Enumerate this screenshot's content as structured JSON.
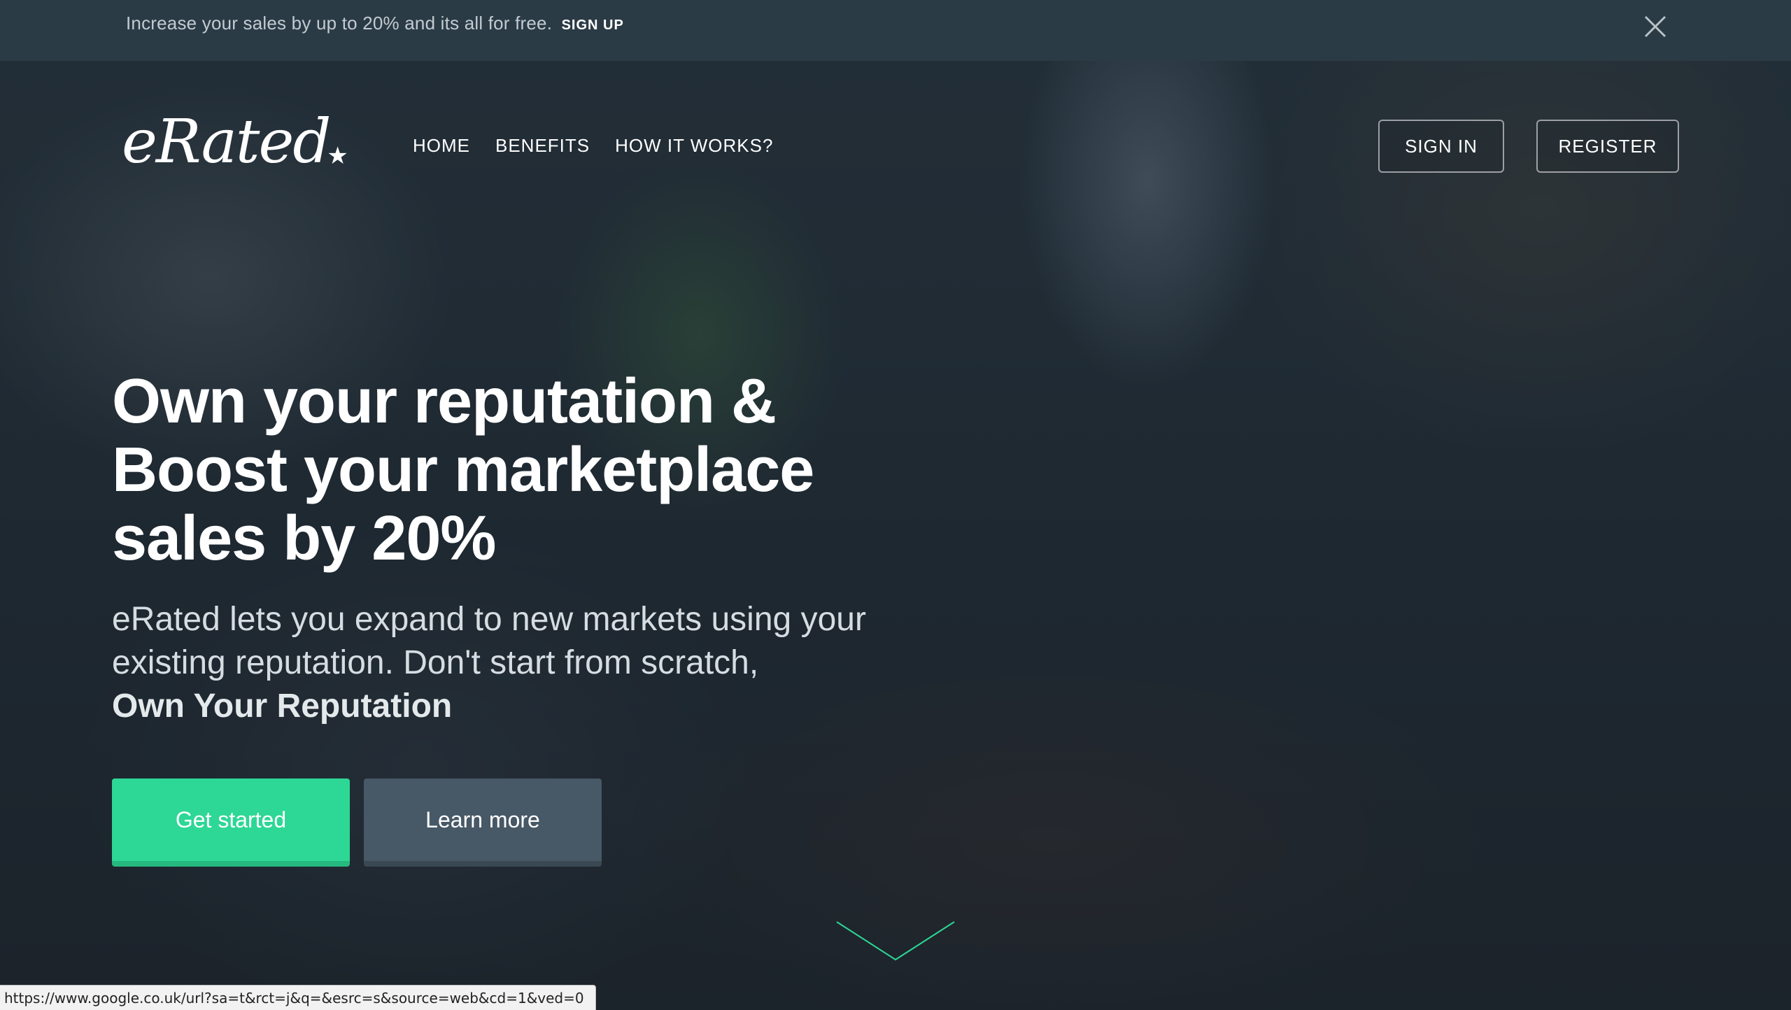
{
  "announcement": {
    "text": "Increase your sales by up to 20% and its all for free.",
    "cta": "SIGN UP",
    "close_icon": "close-icon"
  },
  "brand": {
    "logo_text": "eRated",
    "logo_star": "★"
  },
  "nav": {
    "items": [
      {
        "label": "HOME"
      },
      {
        "label": "BENEFITS"
      },
      {
        "label": "HOW IT WORKS?"
      }
    ],
    "sign_in": "SIGN IN",
    "register": "REGISTER"
  },
  "hero": {
    "headline_lines": [
      "Own your reputation &",
      "Boost your marketplace",
      "sales by 20%"
    ],
    "subtext_lines": [
      "eRated lets you expand to new markets using your",
      "existing reputation. Don't start from scratch,"
    ],
    "subtext_strong": "Own Your Reputation",
    "primary_button": "Get started",
    "secondary_button": "Learn more",
    "scroll_icon": "chevron-down-icon"
  },
  "status_bar": {
    "url": "https://www.google.co.uk/url?sa=t&rct=j&q=&esrc=s&source=web&cd=1&ved=0"
  },
  "colors": {
    "accent_green": "#2dd795",
    "secondary_button": "#475866",
    "announcement_bar": "#2b3b46"
  }
}
